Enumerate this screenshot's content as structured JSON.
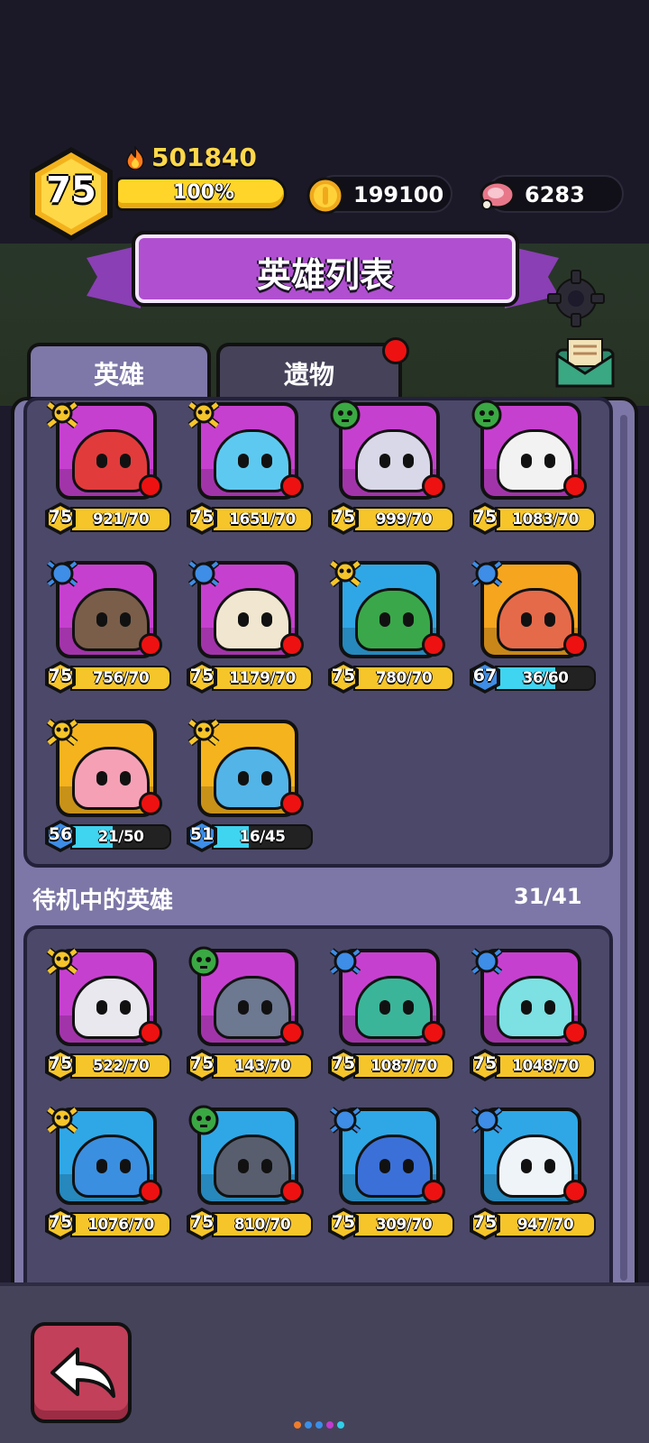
{
  "header": {
    "player_level": "75",
    "power": "501840",
    "xp_percent": "100%",
    "gold": "199100",
    "meat": "6283",
    "title": "英雄列表"
  },
  "tabs": [
    {
      "label": "英雄",
      "active": true
    },
    {
      "label": "遗物",
      "active": false,
      "has_notification": true
    }
  ],
  "team_heroes": [
    {
      "level": "75",
      "cards": "921/70",
      "rank": "gold",
      "bg": "#c640cf",
      "face": "#e23b3b",
      "capped": true,
      "progress": 1.0
    },
    {
      "level": "75",
      "cards": "1651/70",
      "rank": "gold",
      "bg": "#c640cf",
      "face": "#5ec9f0",
      "capped": true,
      "progress": 1.0
    },
    {
      "level": "75",
      "cards": "999/70",
      "rank": "green",
      "bg": "#c640cf",
      "face": "#d8d8e8",
      "capped": true,
      "progress": 1.0
    },
    {
      "level": "75",
      "cards": "1083/70",
      "rank": "green",
      "bg": "#c640cf",
      "face": "#f2f2f2",
      "capped": true,
      "progress": 1.0
    },
    {
      "level": "75",
      "cards": "756/70",
      "rank": "blue",
      "bg": "#c640cf",
      "face": "#7a5e4a",
      "capped": true,
      "progress": 1.0
    },
    {
      "level": "75",
      "cards": "1179/70",
      "rank": "blue",
      "bg": "#c640cf",
      "face": "#f1e6cf",
      "capped": true,
      "progress": 1.0
    },
    {
      "level": "75",
      "cards": "780/70",
      "rank": "gold",
      "bg": "#2fa7e6",
      "face": "#3aa84a",
      "capped": true,
      "progress": 1.0
    },
    {
      "level": "67",
      "cards": "36/60",
      "rank": "blue",
      "bg": "#f5a51e",
      "face": "#e56a4a",
      "capped": false,
      "progress": 0.6
    },
    {
      "level": "56",
      "cards": "21/50",
      "rank": "gold",
      "bg": "#f5b31e",
      "face": "#f6a0b6",
      "capped": false,
      "progress": 0.42
    },
    {
      "level": "51",
      "cards": "16/45",
      "rank": "gold",
      "bg": "#f5b31e",
      "face": "#53b4e8",
      "capped": false,
      "progress": 0.36
    }
  ],
  "standby": {
    "title": "待机中的英雄",
    "count": "31/41",
    "heroes": [
      {
        "level": "75",
        "cards": "522/70",
        "rank": "gold",
        "bg": "#c640cf",
        "face": "#e8e8ee",
        "capped": true,
        "progress": 1.0
      },
      {
        "level": "75",
        "cards": "143/70",
        "rank": "green",
        "bg": "#c640cf",
        "face": "#6d7891",
        "capped": true,
        "progress": 1.0
      },
      {
        "level": "75",
        "cards": "1087/70",
        "rank": "blue",
        "bg": "#c640cf",
        "face": "#3bb59a",
        "capped": true,
        "progress": 1.0
      },
      {
        "level": "75",
        "cards": "1048/70",
        "rank": "blue",
        "bg": "#c640cf",
        "face": "#7de0e2",
        "capped": true,
        "progress": 1.0
      },
      {
        "level": "75",
        "cards": "1076/70",
        "rank": "gold",
        "bg": "#2fa7e6",
        "face": "#3b8fe0",
        "capped": true,
        "progress": 1.0
      },
      {
        "level": "75",
        "cards": "810/70",
        "rank": "green",
        "bg": "#2fa7e6",
        "face": "#585e6e",
        "capped": true,
        "progress": 1.0
      },
      {
        "level": "75",
        "cards": "309/70",
        "rank": "blue",
        "bg": "#2fa7e6",
        "face": "#3b70d8",
        "capped": true,
        "progress": 1.0
      },
      {
        "level": "75",
        "cards": "947/70",
        "rank": "blue",
        "bg": "#2fa7e6",
        "face": "#eef4f8",
        "capped": true,
        "progress": 1.0
      }
    ]
  },
  "colors": {
    "gold": "#f6c52a",
    "green": "#3aa843",
    "blue": "#3e8de6",
    "progress_cyan": "#3fd4f0",
    "capped_bar": "#f6c52a"
  },
  "icons": {
    "back": "back-arrow-icon",
    "settings": "gear-icon",
    "mail": "mail-icon",
    "power": "fire-icon",
    "gold": "gold-coin-icon",
    "meat": "meat-icon"
  }
}
